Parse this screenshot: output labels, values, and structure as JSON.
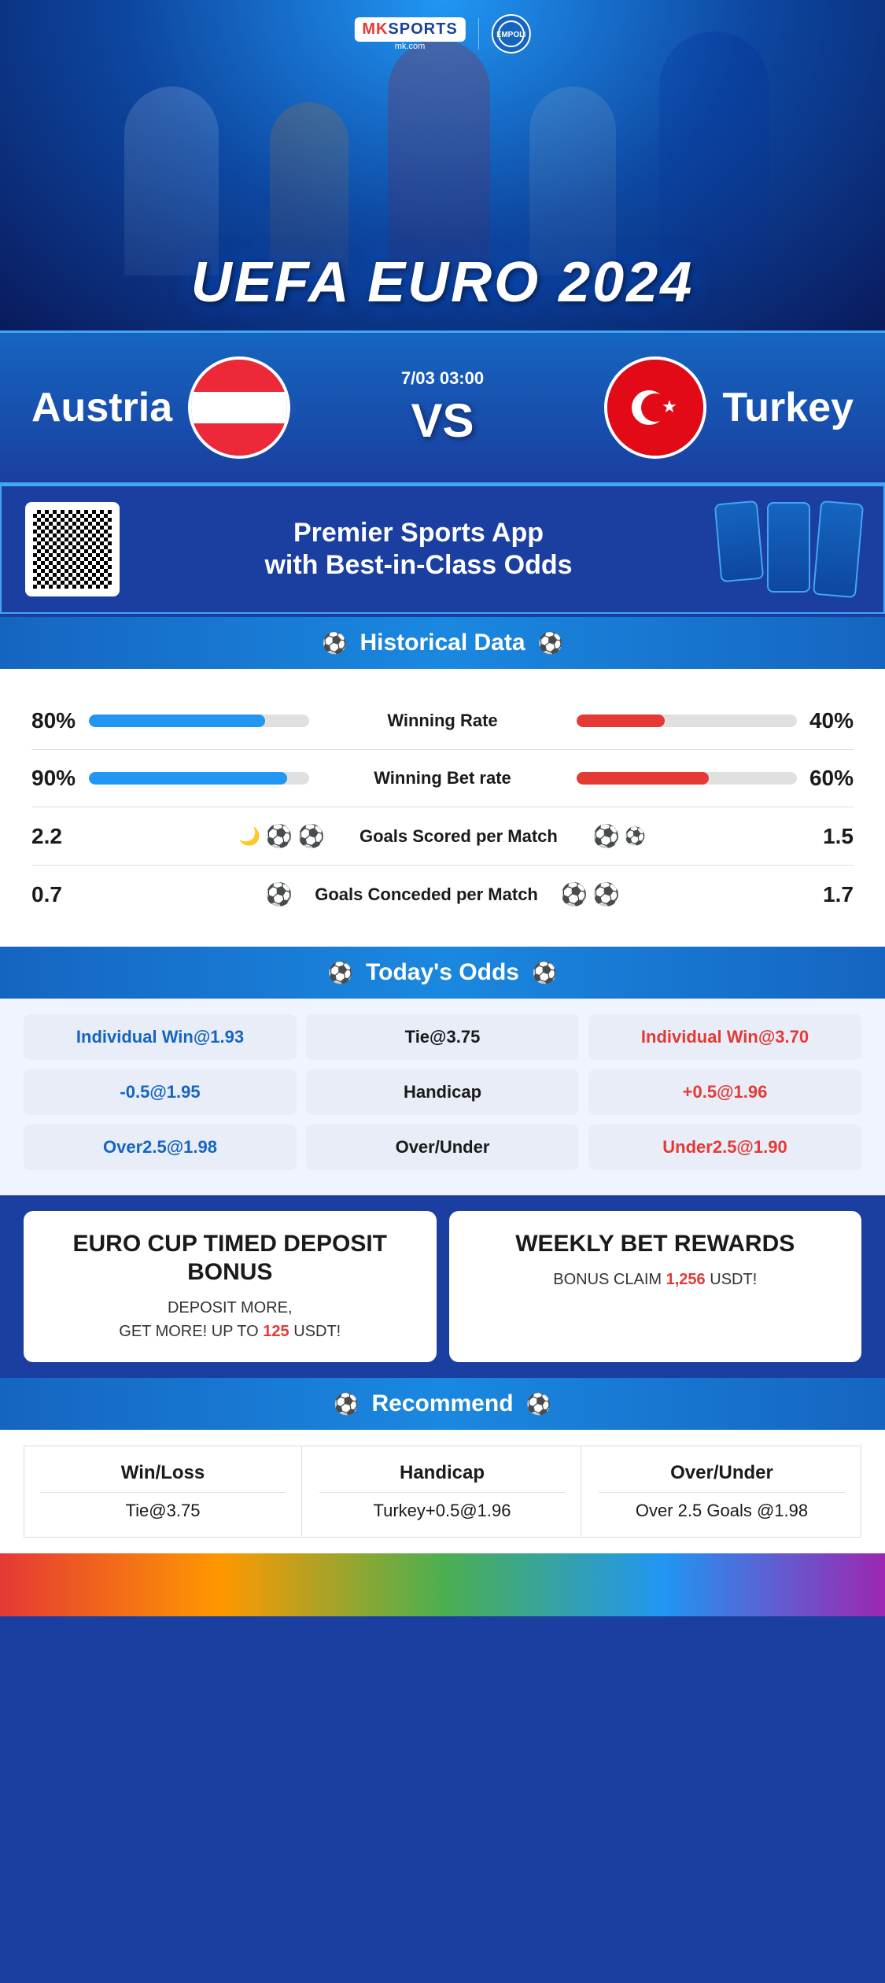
{
  "header": {
    "logo_mk": "MK",
    "logo_sports": "SPORTS",
    "logo_domain": "mk.com",
    "logo_divider": "|",
    "title": "UEFA EURO 2024"
  },
  "match": {
    "team_left": "Austria",
    "team_right": "Turkey",
    "date": "7/03 03:00",
    "vs": "VS"
  },
  "promo": {
    "title": "Premier Sports App\nwith Best-in-Class Odds"
  },
  "historical": {
    "section_title": "Historical Data",
    "stats": [
      {
        "label": "Winning Rate",
        "left_val": "80%",
        "right_val": "40%",
        "left_pct": 80,
        "right_pct": 40
      },
      {
        "label": "Winning Bet rate",
        "left_val": "90%",
        "right_val": "60%",
        "left_pct": 90,
        "right_pct": 60
      },
      {
        "label": "Goals Scored per Match",
        "left_val": "2.2",
        "right_val": "1.5"
      },
      {
        "label": "Goals Conceded per Match",
        "left_val": "0.7",
        "right_val": "1.7"
      }
    ]
  },
  "odds": {
    "section_title": "Today's Odds",
    "row1": {
      "left": "Individual Win@1.93",
      "center": "Tie@3.75",
      "right": "Individual Win@3.70"
    },
    "row2": {
      "left": "-0.5@1.95",
      "center": "Handicap",
      "right": "+0.5@1.96"
    },
    "row3": {
      "left": "Over2.5@1.98",
      "center": "Over/Under",
      "right": "Under2.5@1.90"
    }
  },
  "bonus": {
    "card1_title": "EURO CUP TIMED DEPOSIT BONUS",
    "card1_desc1": "DEPOSIT MORE,",
    "card1_desc2": "GET MORE! UP TO",
    "card1_highlight": "125",
    "card1_currency": "USDT!",
    "card2_title": "WEEKLY BET REWARDS",
    "card2_desc": "BONUS CLAIM",
    "card2_highlight": "1,256",
    "card2_currency": "USDT!"
  },
  "recommend": {
    "section_title": "Recommend",
    "col1_header": "Win/Loss",
    "col1_value": "Tie@3.75",
    "col2_header": "Handicap",
    "col2_value": "Turkey+0.5@1.96",
    "col3_header": "Over/Under",
    "col3_value": "Over 2.5 Goals @1.98"
  }
}
